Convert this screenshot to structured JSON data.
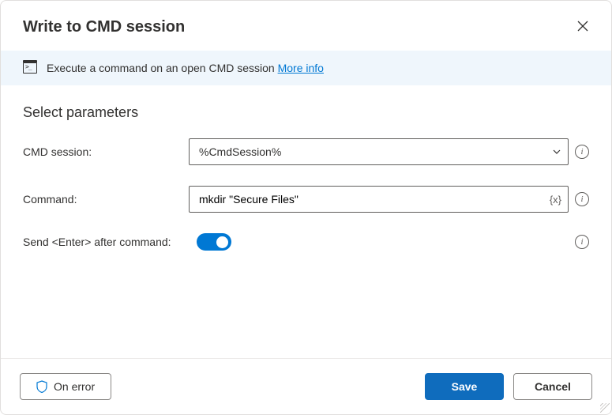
{
  "header": {
    "title": "Write to CMD session"
  },
  "banner": {
    "text": "Execute a command on an open CMD session ",
    "link_text": "More info"
  },
  "section_title": "Select parameters",
  "fields": {
    "cmd_session": {
      "label": "CMD session:",
      "value": "%CmdSession%"
    },
    "command": {
      "label": "Command:",
      "value": "mkdir \"Secure Files\"",
      "var_badge": "{x}"
    },
    "send_enter": {
      "label": "Send <Enter> after command:",
      "on": true
    }
  },
  "footer": {
    "on_error": "On error",
    "save": "Save",
    "cancel": "Cancel"
  }
}
